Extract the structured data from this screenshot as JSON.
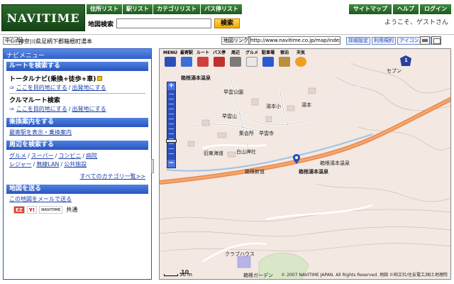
{
  "header": {
    "logo": "NAVITIME",
    "nav": [
      "住所リスト",
      "駅リスト",
      "カテゴリリスト",
      "バス停リスト"
    ],
    "right_nav": [
      "サイトマップ",
      "ヘルプ",
      "ログイン"
    ],
    "welcome": "ようこそ、ゲストさん",
    "search_label": "地図検索",
    "search_value": "",
    "search_button": "検索"
  },
  "address_bar": {
    "center_button": "中心点",
    "address": "神奈川県足柄下郡箱根町湯本",
    "link_button": "地図リンク",
    "url": "http://www.navitime.co.jp/map/index.jsp?",
    "buttons": [
      "詳細設定",
      "利用規約",
      "アイコン凡例"
    ]
  },
  "sidebar": {
    "title": "ナビメニュー",
    "route": {
      "header": "ルートを検索する",
      "total_navi": "トータルナビ(乗換+徒歩+車)",
      "from_here": "ここを目的地にする",
      "to_here": "出発地にする",
      "car_route": "クルマルート検索",
      "car_from": "ここを目的地にする",
      "car_to": "出発地にする"
    },
    "transit": {
      "header": "乗換案内をする",
      "link": "最寄駅を表示・乗換案内"
    },
    "nearby": {
      "header": "周辺を検索する",
      "row1": [
        "グルメ",
        "スーパー",
        "コンビニ",
        "病院"
      ],
      "row2": [
        "レジャー",
        "無線LAN",
        "公共施設"
      ],
      "all": "すべてのカテゴリ一覧>>"
    },
    "send": {
      "header": "地図を送る",
      "mail": "この地図をメールで送る",
      "partners": [
        "EZ",
        "Y!",
        "NAVITIME",
        "共通"
      ]
    }
  },
  "map": {
    "toolbar": [
      "MENU",
      "最寄駅",
      "ルート",
      "バス停",
      "周辺",
      "グルメ",
      "駐車場",
      "宿泊",
      "天気"
    ],
    "labels": [
      "箱根湯本温泉",
      "早雲公園",
      "湯本小",
      "湯本",
      "早雲山",
      "旧東海道",
      "白山神社",
      "箱根新道",
      "箱根湯本温泉",
      "クラブハウス",
      "集会所",
      "箱根ガーデン",
      "早雲寺",
      "セブン"
    ],
    "pin_label": "箱根湯本温泉",
    "scale": "50 m",
    "route_number": "1",
    "grid_number": "10",
    "copyright": "© 2007 NAVITIME JAPAN. All Rights Reserved. 地図 ©昭文社/住友電工/国土地理院"
  },
  "colors": {
    "brand_green": "#1d5a1d",
    "menu_blue": "#2f5fc9",
    "highway": "#e8884a",
    "map_bg": "#f3e8e2"
  }
}
